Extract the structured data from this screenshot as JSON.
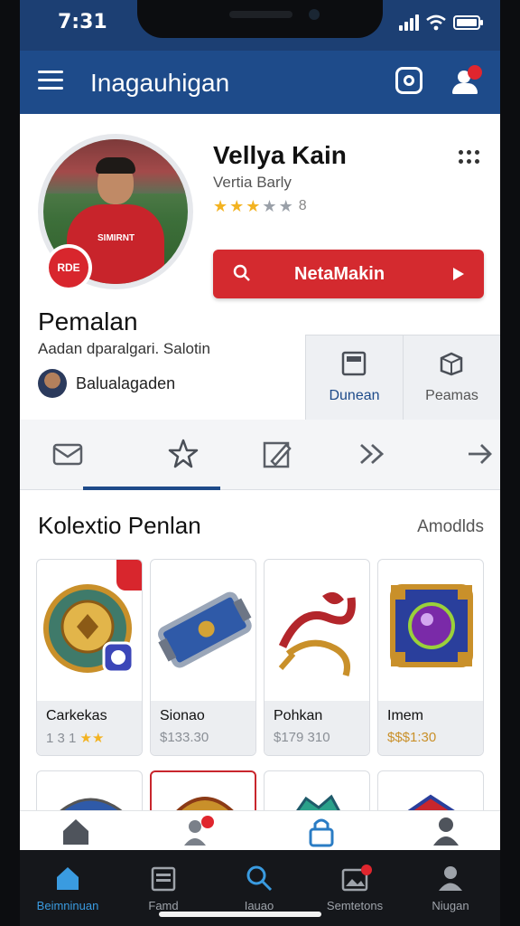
{
  "status": {
    "time": "7:31"
  },
  "header": {
    "title": "Inagauhigan"
  },
  "profile": {
    "name": "Vellya Kain",
    "subtitle": "Vertia Barly",
    "rating": {
      "stars": 3,
      "max": 5,
      "value": "8"
    },
    "club_badge": "RDE",
    "shirt_text": "SIMIRNT",
    "action_label": "NetaMakin",
    "section_title": "Pemalan",
    "section_desc": "Aadan dparalgari. Salotin",
    "club_name": "Balualagaden",
    "tiles": [
      {
        "label": "Dunean",
        "icon": "window-icon"
      },
      {
        "label": "Peamas",
        "icon": "box-icon"
      }
    ]
  },
  "tabs": [
    {
      "icon": "mail-icon"
    },
    {
      "icon": "star-icon"
    },
    {
      "icon": "edit-icon"
    },
    {
      "icon": "double-chevron-icon"
    },
    {
      "icon": "arrow-right-icon"
    }
  ],
  "collection": {
    "title": "Kolextio Penlan",
    "link": "Amodlds",
    "items": [
      {
        "name": "Carkekas",
        "price": "1 3 1",
        "art": "medallion"
      },
      {
        "name": "Sionao",
        "price": "$133.30",
        "art": "plate"
      },
      {
        "name": "Pohkan",
        "price": "$179 310",
        "art": "rope"
      },
      {
        "name": "Imem",
        "price": "$$$1:30",
        "art": "gem-box"
      }
    ]
  },
  "bottom_nav": [
    {
      "label": "Beimninuan",
      "icon": "home-icon",
      "active": true
    },
    {
      "label": "Famd",
      "icon": "calendar-icon",
      "active": false
    },
    {
      "label": "Iauao",
      "icon": "search-icon",
      "active": false
    },
    {
      "label": "Semtetons",
      "icon": "photos-icon",
      "active": false
    },
    {
      "label": "Niugan",
      "icon": "person-icon",
      "active": false
    }
  ],
  "colors": {
    "brand": "#1e4b8a",
    "accent": "#d42a2f",
    "active": "#3a9be0"
  }
}
